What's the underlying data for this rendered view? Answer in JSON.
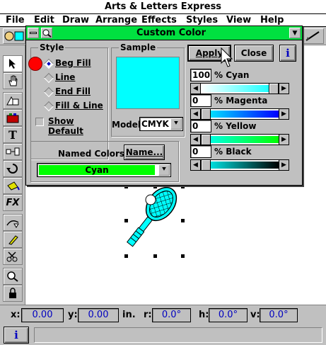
{
  "app": {
    "title": "Arts & Letters Express"
  },
  "menu": [
    "File",
    "Edit",
    "Draw",
    "Arrange",
    "Effects",
    "Styles",
    "View",
    "Help"
  ],
  "dialog": {
    "title": "Custom Color",
    "style_group_label": "Style",
    "style_options": [
      "Beg Fill",
      "Line",
      "End Fill",
      "Fill & Line"
    ],
    "selected_style": "Beg Fill",
    "show_default_label": "Show Default",
    "sample_label": "Sample",
    "sample_color": "#00ffff",
    "model_label": "Model",
    "model_value": "CMYK",
    "named_colors_label": "Named Colors",
    "name_button": "Name...",
    "named_color_value": "Cyan",
    "named_color_swatch": "#00ff00",
    "apply_button": "Apply",
    "close_button": "Close",
    "info_button": "i",
    "sliders": [
      {
        "label": "% Cyan",
        "value": "100",
        "level": 1.0
      },
      {
        "label": "% Magenta",
        "value": "0",
        "level": 0.0
      },
      {
        "label": "% Yellow",
        "value": "0",
        "level": 0.0
      },
      {
        "label": "% Black",
        "value": "0",
        "level": 0.0
      }
    ]
  },
  "status": {
    "x_label": "x:",
    "x_value": "0.00",
    "y_label": "y:",
    "y_value": "0.00",
    "unit": "in.",
    "r_label": "r:",
    "r_value": "0.0°",
    "h_label": "h:",
    "h_value": "0.0°",
    "v_label": "v:",
    "v_value": "0.0°",
    "info_button": "i"
  },
  "colors": {
    "title_bar": "#00e040",
    "accent_text": "#0000c0",
    "cyan": "#00ffff"
  }
}
